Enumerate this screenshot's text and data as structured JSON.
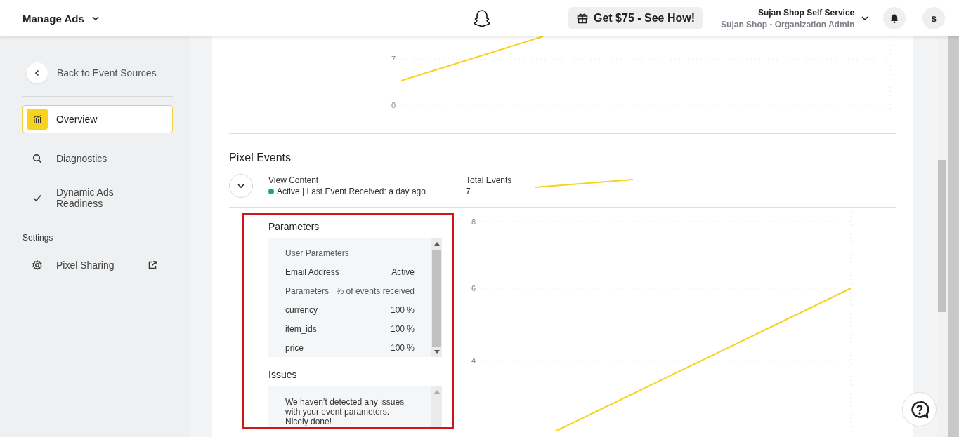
{
  "header": {
    "title": "Manage Ads",
    "promo": "Get $75 - See How!",
    "account": {
      "name": "Sujan Shop Self Service",
      "role": "Sujan Shop - Organization Admin"
    },
    "avatar": "s"
  },
  "sidebar": {
    "back": "Back to Event Sources",
    "items": [
      {
        "label": "Overview",
        "selected": true
      },
      {
        "label": "Diagnostics",
        "selected": false
      },
      {
        "label": "Dynamic Ads Readiness",
        "selected": false
      }
    ],
    "settings_heading": "Settings",
    "settings_items": [
      {
        "label": "Pixel Sharing",
        "external": true
      }
    ]
  },
  "top_chart": {
    "axis_labels": [
      "7",
      "0"
    ]
  },
  "pixel_events": {
    "title": "Pixel Events",
    "events": [
      {
        "name": "View Content",
        "expanded": true,
        "active": true,
        "status": "Active | Last Event Received: a day ago",
        "total_label": "Total Events",
        "total": "7"
      }
    ]
  },
  "parameters": {
    "title": "Parameters",
    "rows": [
      {
        "kind": "heading",
        "label": "User Parameters"
      },
      {
        "kind": "row",
        "label": "Email Address",
        "value": "Active"
      },
      {
        "kind": "header",
        "label": "Parameters",
        "value": "% of events received"
      },
      {
        "kind": "row",
        "label": "currency",
        "value": "100 %"
      },
      {
        "kind": "row",
        "label": "item_ids",
        "value": "100 %"
      },
      {
        "kind": "row",
        "label": "price",
        "value": "100 %"
      }
    ]
  },
  "issues": {
    "title": "Issues",
    "message": "We haven’t detected any issues with your event parameters. Nicely done!"
  },
  "detail_chart": {
    "axis_labels": [
      "8",
      "6",
      "4"
    ]
  }
}
